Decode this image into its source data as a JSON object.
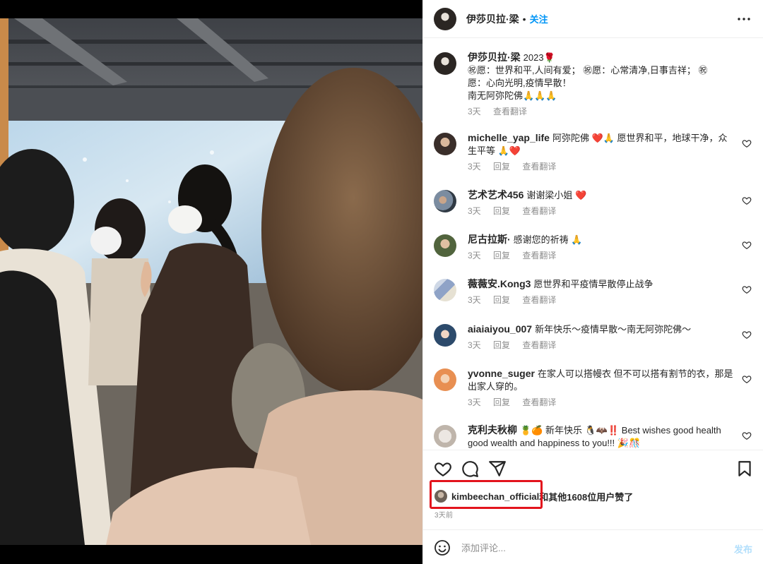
{
  "post": {
    "author": "伊莎贝拉·梁",
    "separator": "•",
    "follow_label": "关注",
    "caption_text": "2023🌹",
    "caption_lines": [
      "㊗愿：世界和平,人间有爱； ㊗愿：心常清净,日事吉祥； ㊗",
      "愿：心向光明,疫情早散！",
      "南无阿弥陀佛🙏🙏🙏"
    ],
    "caption_time": "3天",
    "translate_label": "查看翻译"
  },
  "comments": [
    {
      "user": "michelle_yap_life",
      "text": "阿弥陀佛 ❤️🙏 愿世界和平，地球干净，众生平等 🙏❤️",
      "time": "3天",
      "reply": "回复",
      "translate": "查看翻译"
    },
    {
      "user": "艺术艺术456",
      "text": "谢谢梁小姐 ❤️",
      "time": "3天",
      "reply": "回复",
      "translate": "查看翻译"
    },
    {
      "user": "尼古拉斯·",
      "text": "感谢您的祈祷 🙏",
      "time": "3天",
      "reply": "回复",
      "translate": "查看翻译"
    },
    {
      "user": "薇薇安.Kong3",
      "text": "愿世界和平疫情早散停止战争",
      "time": "3天",
      "reply": "回复",
      "translate": "查看翻译"
    },
    {
      "user": "aiaiaiyou_007",
      "text": "新年快乐～疫情早散～南无阿弥陀佛～",
      "time": "3天",
      "reply": "回复",
      "translate": "查看翻译"
    },
    {
      "user": "yvonne_suger",
      "text": "在家人可以搭幔衣 但不可以搭有割节的衣，那是出家人穿的。",
      "time": "3天",
      "reply": "回复",
      "translate": "查看翻译"
    },
    {
      "user": "克利夫秋柳",
      "text": "🍍🍊 新年快乐 🐧🦇‼️ Best wishes good health good wealth and happiness to you!!! 🎉🎊",
      "time": "",
      "reply": "",
      "translate": ""
    }
  ],
  "likes": {
    "user": "kimbeechan_official",
    "rest": "和其他1608位用户赞了"
  },
  "post_time": "3天前",
  "add_comment": {
    "placeholder": "添加评论...",
    "post_label": "发布"
  },
  "colors": {
    "accent": "#0095f6",
    "post_disabled": "#b2dffc",
    "highlight": "#e3141d",
    "heart": "#ed4956",
    "muted": "#8e8e8e"
  }
}
